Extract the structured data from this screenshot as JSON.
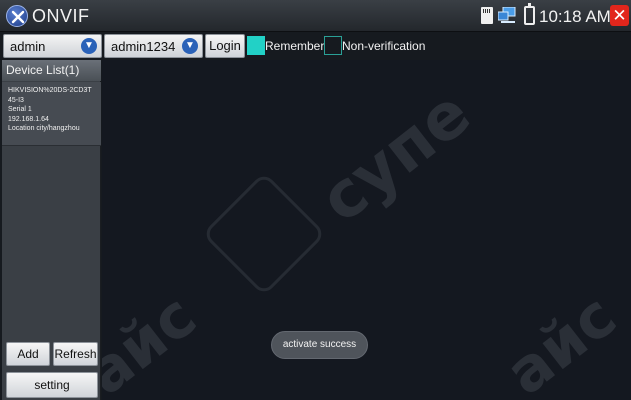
{
  "app": {
    "title": "ONVIF"
  },
  "status": {
    "time": "10:18 AM"
  },
  "toolbar": {
    "username": "admin",
    "password": "admin1234",
    "login_label": "Login",
    "remember_label": "Remember",
    "remember_checked": true,
    "nonverify_label": "Non-verification",
    "nonverify_checked": false
  },
  "sidebar": {
    "header": "Device List(1)",
    "devices": [
      {
        "name_line1": "HIKVISION%20DS-2CD3T",
        "name_line2": "45-I3",
        "serial": "Serial 1",
        "ip": "192.168.1.64",
        "location": "Location city/hangzhou"
      }
    ],
    "add_label": "Add",
    "refresh_label": "Refresh",
    "setting_label": "setting"
  },
  "toast": {
    "message": "activate success"
  },
  "colors": {
    "checkbox_on": "#22d1c6",
    "close": "#e2261c",
    "icon_blue": "#2a62b8"
  }
}
